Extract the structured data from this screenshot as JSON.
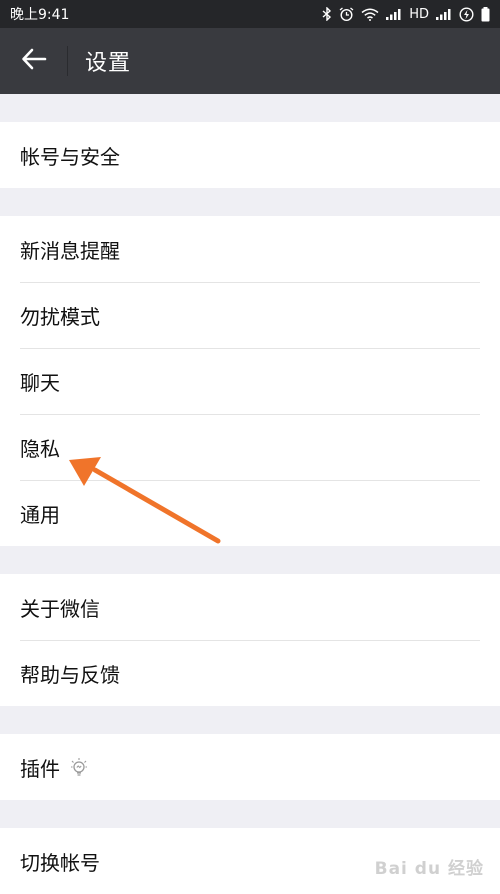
{
  "status_bar": {
    "time": "晚上9:41",
    "network": "HD"
  },
  "app_bar": {
    "title": "设置"
  },
  "groups": [
    {
      "items": [
        {
          "label": "帐号与安全"
        }
      ]
    },
    {
      "items": [
        {
          "label": "新消息提醒"
        },
        {
          "label": "勿扰模式"
        },
        {
          "label": "聊天"
        },
        {
          "label": "隐私"
        },
        {
          "label": "通用"
        }
      ]
    },
    {
      "items": [
        {
          "label": "关于微信"
        },
        {
          "label": "帮助与反馈"
        }
      ]
    },
    {
      "items": [
        {
          "label": "插件",
          "icon": "lightbulb-icon"
        }
      ]
    },
    {
      "items": [
        {
          "label": "切换帐号"
        }
      ]
    }
  ],
  "watermark": "Bai du 经验",
  "colors": {
    "status_bar": "#252629",
    "app_bar": "#393a3f",
    "background": "#efeff4",
    "arrow": "#f0742a"
  }
}
